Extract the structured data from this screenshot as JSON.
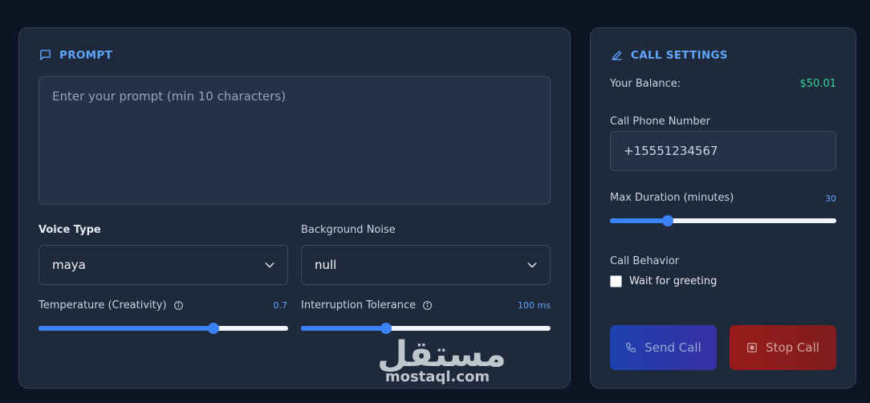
{
  "prompt_panel": {
    "title": "PROMPT",
    "textarea_placeholder": "Enter your prompt (min 10 characters)",
    "voice_type": {
      "label": "Voice Type",
      "value": "maya"
    },
    "background_noise": {
      "label": "Background Noise",
      "value": "null"
    },
    "temperature": {
      "label": "Temperature (Creativity)",
      "value_text": "0.7",
      "fraction": 0.7
    },
    "interruption": {
      "label": "Interruption Tolerance",
      "value_text": "100 ms",
      "fraction": 0.34
    }
  },
  "settings_panel": {
    "title": "CALL SETTINGS",
    "balance_label": "Your Balance:",
    "balance_value": "$50.01",
    "phone_label": "Call Phone Number",
    "phone_value": "+15551234567",
    "duration": {
      "label": "Max Duration (minutes)",
      "value_text": "30",
      "fraction": 0.255
    },
    "behavior_label": "Call Behavior",
    "wait_greeting_label": "Wait for greeting",
    "wait_greeting_checked": false,
    "send_call_label": "Send Call",
    "stop_call_label": "Stop Call"
  },
  "watermark": {
    "arabic": "مستقل",
    "latin": "mostaql.com"
  },
  "colors": {
    "accent": "#60a5fa",
    "slider_fill": "#3b82f6",
    "balance": "#34d399",
    "send_button": "#1e40af",
    "stop_button": "#991b1b"
  },
  "icons": {
    "prompt": "chat-bubble-icon",
    "settings": "pencil-icon",
    "info": "info-icon",
    "send": "phone-icon",
    "stop": "stop-square-icon",
    "dropdown": "chevron-down-icon"
  }
}
